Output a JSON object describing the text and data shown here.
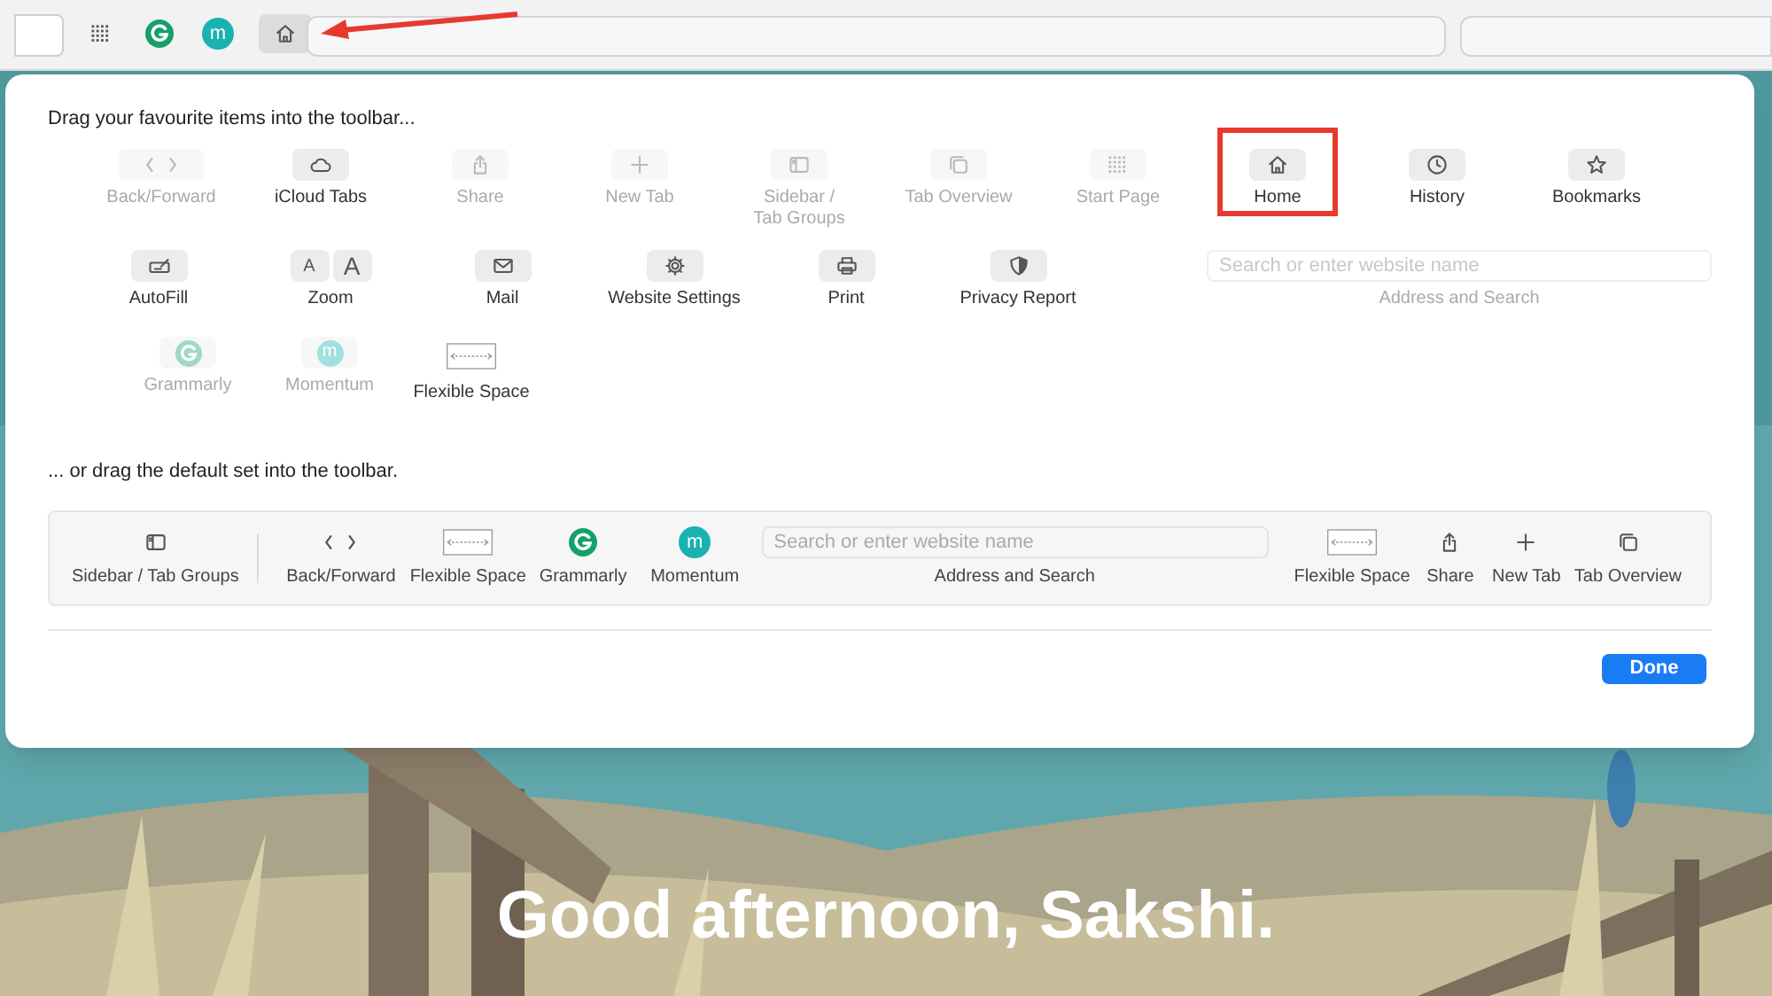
{
  "browser_toolbar": {
    "extensions": [
      {
        "kind": "grid",
        "annotated": false
      },
      {
        "kind": "grammarly",
        "annotated": false
      },
      {
        "kind": "momentum",
        "badge": "m",
        "annotated": false
      },
      {
        "kind": "home",
        "annotated": true
      }
    ]
  },
  "background": {
    "kind": "picture",
    "greeting": "Good afternoon, Sakshi."
  },
  "customize_sheet": {
    "instruction": "Drag your favourite items into the toolbar...",
    "palette": [
      [
        {
          "kind": "back_forward",
          "label": "Back/Forward",
          "disabled": true,
          "annotated": false
        },
        {
          "kind": "cloud",
          "label": "iCloud Tabs",
          "disabled": false,
          "annotated": false
        },
        {
          "kind": "share",
          "label": "Share",
          "disabled": true,
          "annotated": false
        },
        {
          "kind": "plus",
          "label": "New Tab",
          "disabled": true,
          "annotated": false
        },
        {
          "kind": "sidebar",
          "label": "Sidebar /\nTab Groups",
          "disabled": true,
          "annotated": false
        },
        {
          "kind": "tabs",
          "label": "Tab Overview",
          "disabled": true,
          "annotated": false
        },
        {
          "kind": "grid",
          "label": "Start Page",
          "disabled": true,
          "annotated": false
        },
        {
          "kind": "home",
          "label": "Home",
          "disabled": false,
          "annotated": true
        },
        {
          "kind": "clock",
          "label": "History",
          "disabled": false,
          "annotated": false
        },
        {
          "kind": "star",
          "label": "Bookmarks",
          "disabled": false,
          "annotated": false
        }
      ],
      [
        {
          "kind": "autofill",
          "label": "AutoFill",
          "disabled": false,
          "annotated": false
        },
        {
          "kind": "zoom",
          "glyphs": [
            "A",
            "A"
          ],
          "label": "Zoom",
          "disabled": false,
          "annotated": false
        },
        {
          "kind": "mail",
          "label": "Mail",
          "disabled": false,
          "annotated": false
        },
        {
          "kind": "gear",
          "label": "Website Settings",
          "disabled": false,
          "annotated": false
        },
        {
          "kind": "print",
          "label": "Print",
          "disabled": false,
          "annotated": false
        },
        {
          "kind": "shield",
          "label": "Privacy Report",
          "disabled": false,
          "annotated": false
        },
        {
          "kind": "address",
          "placeholder": "Search or enter website name",
          "label": "Address and Search",
          "disabled": true,
          "annotated": false
        }
      ],
      [
        {
          "kind": "grammarly",
          "label": "Grammarly",
          "disabled": true,
          "annotated": false
        },
        {
          "kind": "momentum",
          "badge": "m",
          "label": "Momentum",
          "disabled": true,
          "annotated": false
        },
        {
          "kind": "flex_space",
          "label": "Flexible Space",
          "disabled": false,
          "annotated": false
        }
      ]
    ],
    "default_set_label": "... or drag the default set into the toolbar.",
    "default_set": [
      {
        "kind": "sidebar",
        "label": "Sidebar / Tab Groups"
      },
      {
        "kind": "divider"
      },
      {
        "kind": "back_forward",
        "label": "Back/Forward"
      },
      {
        "kind": "flex_space",
        "label": "Flexible Space"
      },
      {
        "kind": "grammarly",
        "label": "Grammarly"
      },
      {
        "kind": "momentum",
        "badge": "m",
        "label": "Momentum"
      },
      {
        "kind": "address",
        "placeholder": "Search or enter website name",
        "label": "Address and Search"
      },
      {
        "kind": "flex_space",
        "label": "Flexible Space"
      },
      {
        "kind": "share",
        "label": "Share"
      },
      {
        "kind": "plus",
        "label": "New Tab"
      },
      {
        "kind": "tabs",
        "label": "Tab Overview"
      }
    ],
    "done_button": "Done"
  }
}
